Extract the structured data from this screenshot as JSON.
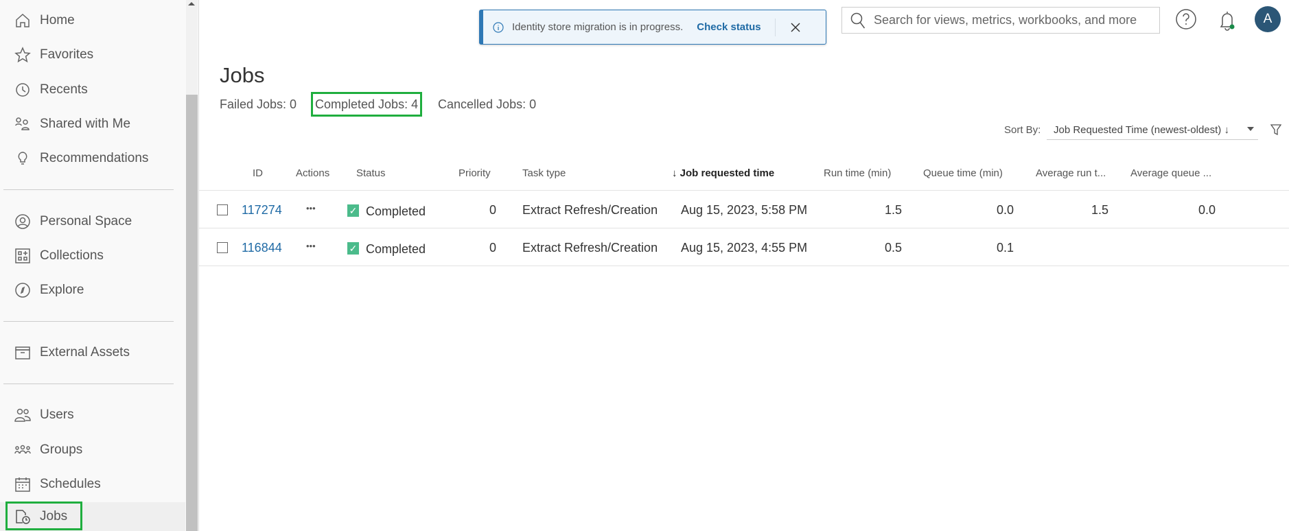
{
  "sidebar": {
    "items": [
      {
        "label": "Home",
        "icon": "home-icon"
      },
      {
        "label": "Favorites",
        "icon": "star-icon"
      },
      {
        "label": "Recents",
        "icon": "clock-icon"
      },
      {
        "label": "Shared with Me",
        "icon": "shared-icon"
      },
      {
        "label": "Recommendations",
        "icon": "lightbulb-icon"
      },
      {
        "label": "Personal Space",
        "icon": "user-circle-icon"
      },
      {
        "label": "Collections",
        "icon": "collections-icon"
      },
      {
        "label": "Explore",
        "icon": "compass-icon"
      },
      {
        "label": "External Assets",
        "icon": "archive-icon"
      },
      {
        "label": "Users",
        "icon": "users-icon"
      },
      {
        "label": "Groups",
        "icon": "groups-icon"
      },
      {
        "label": "Schedules",
        "icon": "calendar-icon"
      },
      {
        "label": "Jobs",
        "icon": "jobs-icon"
      }
    ]
  },
  "banner": {
    "message": "Identity store migration is in progress.",
    "link": "Check status"
  },
  "search": {
    "placeholder": "Search for views, metrics, workbooks, and more"
  },
  "header": {
    "avatar": "A"
  },
  "page": {
    "title": "Jobs",
    "failed": "Failed Jobs: 0",
    "completed": "Completed Jobs: 4",
    "cancelled": "Cancelled Jobs: 0",
    "sort_label": "Sort By:",
    "sort_value": "Job Requested Time (newest-oldest) ↓"
  },
  "table": {
    "columns": [
      "ID",
      "Actions",
      "Status",
      "Priority",
      "Task type",
      "↓ Job requested time",
      "Run time (min)",
      "Queue time (min)",
      "Average run t...",
      "Average queue ..."
    ],
    "rows": [
      {
        "id": "117274",
        "actions": "•••",
        "status": "Completed",
        "priority": "0",
        "task": "Extract Refresh/Creation",
        "time": "Aug 15, 2023, 5:58 PM",
        "run": "1.5",
        "queue": "0.0",
        "avg_run": "1.5",
        "avg_queue": "0.0"
      },
      {
        "id": "116844",
        "actions": "•••",
        "status": "Completed",
        "priority": "0",
        "task": "Extract Refresh/Creation",
        "time": "Aug 15, 2023, 4:55 PM",
        "run": "0.5",
        "queue": "0.1",
        "avg_run": "",
        "avg_queue": ""
      }
    ]
  },
  "colors": {
    "accent": "#2e78b5",
    "success": "#4bbb8b",
    "highlight": "#1fae3e",
    "avatar": "#2b5676"
  }
}
